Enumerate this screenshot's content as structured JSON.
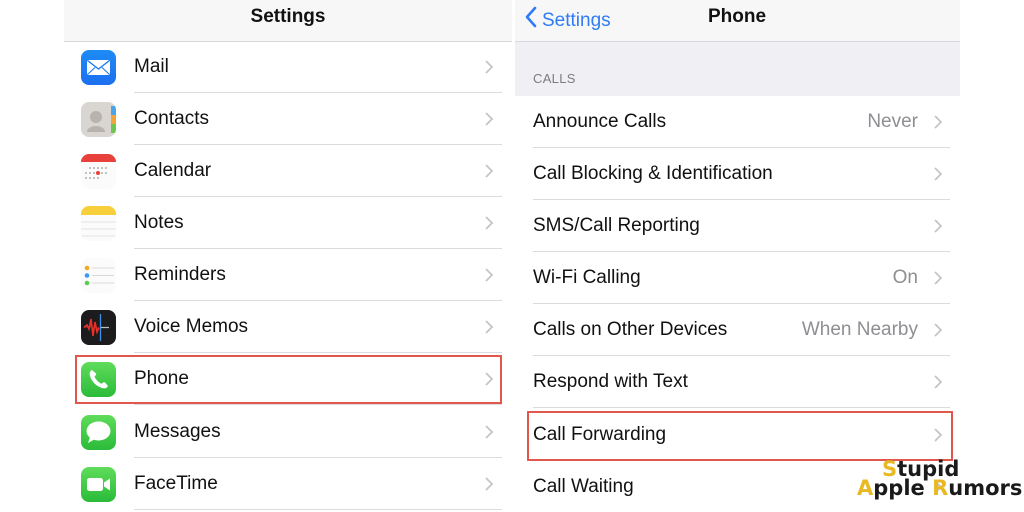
{
  "left_panel": {
    "title": "Settings",
    "items": [
      {
        "label": "Mail",
        "icon": "mail-icon"
      },
      {
        "label": "Contacts",
        "icon": "contacts-icon"
      },
      {
        "label": "Calendar",
        "icon": "calendar-icon"
      },
      {
        "label": "Notes",
        "icon": "notes-icon"
      },
      {
        "label": "Reminders",
        "icon": "reminders-icon"
      },
      {
        "label": "Voice Memos",
        "icon": "voice-memos-icon"
      },
      {
        "label": "Phone",
        "icon": "phone-icon",
        "highlighted": true
      },
      {
        "label": "Messages",
        "icon": "messages-icon"
      },
      {
        "label": "FaceTime",
        "icon": "facetime-icon"
      }
    ]
  },
  "right_panel": {
    "back_label": "Settings",
    "title": "Phone",
    "section_label": "CALLS",
    "items": [
      {
        "label": "Announce Calls",
        "value": "Never"
      },
      {
        "label": "Call Blocking & Identification",
        "value": ""
      },
      {
        "label": "SMS/Call Reporting",
        "value": ""
      },
      {
        "label": "Wi-Fi Calling",
        "value": "On"
      },
      {
        "label": "Calls on Other Devices",
        "value": "When Nearby"
      },
      {
        "label": "Respond with Text",
        "value": ""
      },
      {
        "label": "Call Forwarding",
        "value": "",
        "highlighted": true
      },
      {
        "label": "Call Waiting",
        "value": ""
      }
    ]
  },
  "watermark": {
    "line1_accent": "S",
    "line1_rest": "tupid",
    "line2_accent1": "A",
    "line2_rest1": "pple ",
    "line2_accent2": "R",
    "line2_rest2": "umors"
  },
  "colors": {
    "highlight": "#e2574c",
    "ios_blue": "#2f7cf6",
    "watermark_accent": "#e8b923"
  }
}
